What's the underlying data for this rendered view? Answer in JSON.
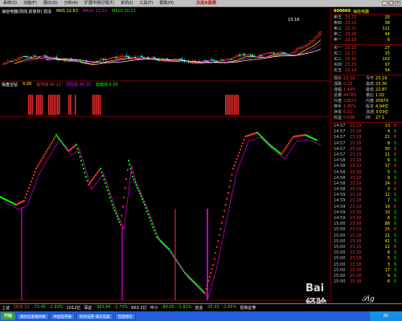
{
  "menubar": {
    "items": [
      "系统(S)",
      "功能(F)",
      "报价(Q)",
      "分析(A)",
      "扩展市场行情(T)",
      "资讯(I)",
      "工具(T)",
      "帮助(H)"
    ],
    "alert": "沉淀水股票"
  },
  "chart_header": {
    "stock": "海信电器(周线,前复权) 隐没",
    "ma5": "MA5 22.83",
    "ma10": "MA10 21.33",
    "ma20": "MA20 20.11"
  },
  "price_label": "23.18",
  "sub_header": {
    "name": "操盘宝钻",
    "v1": "0.00",
    "v2": "操作线 45.12",
    "v3": "风险线 60.15",
    "v4": "稳健线 0.00"
  },
  "quote": {
    "code": "600060",
    "name": "海信电器",
    "asks": [
      {
        "label": "卖五",
        "price": "23.23",
        "vol": "20"
      },
      {
        "label": "卖四",
        "price": "23.22",
        "vol": "38"
      },
      {
        "label": "卖三",
        "price": "23.21",
        "vol": "111"
      },
      {
        "label": "卖二",
        "price": "23.20",
        "vol": "44"
      },
      {
        "label": "卖一",
        "price": "23.19",
        "vol": "6"
      }
    ],
    "bids": [
      {
        "label": "买一",
        "price": "23.18",
        "vol": "27"
      },
      {
        "label": "买二",
        "price": "23.17",
        "vol": "15"
      },
      {
        "label": "买三",
        "price": "23.16",
        "vol": "102"
      },
      {
        "label": "买四",
        "price": "23.15",
        "vol": "97"
      },
      {
        "label": "买五",
        "price": "23.14",
        "vol": "54"
      }
    ],
    "stats": [
      {
        "l1": "现价",
        "v1": "23.18",
        "l2": "今开",
        "v2": "23.19"
      },
      {
        "l1": "涨跌",
        "v1": "0.33",
        "l2": "最高",
        "v2": "23.30"
      },
      {
        "l1": "涨幅",
        "v1": "1.44%",
        "l2": "最低",
        "v2": "22.87"
      },
      {
        "l1": "总量",
        "v1": "44783",
        "l2": "量比",
        "v2": "1.02"
      },
      {
        "l1": "外盘",
        "v1": "23813",
        "l2": "内盘",
        "v2": "20970"
      },
      {
        "l1": "换手",
        "v1": "1.45%",
        "l2": "股本",
        "v2": "4.94亿"
      },
      {
        "l1": "净资",
        "v1": "6.51",
        "l2": "流通",
        "v2": "3.03亿"
      },
      {
        "l1": "收益",
        "v1": "0.638",
        "l2": "PE",
        "v2": "27.1"
      }
    ],
    "ticks": [
      {
        "t": "14:57",
        "p": "23.19",
        "v": "13",
        "bs": "B"
      },
      {
        "t": "14:57",
        "p": "23.18",
        "v": "4",
        "bs": "S"
      },
      {
        "t": "14:57",
        "p": "23.19",
        "v": "21",
        "bs": "B"
      },
      {
        "t": "14:57",
        "p": "23.18",
        "v": "8",
        "bs": "S"
      },
      {
        "t": "14:57",
        "p": "23.18",
        "v": "30",
        "bs": "S"
      },
      {
        "t": "14:57",
        "p": "23.19",
        "v": "11",
        "bs": "B"
      },
      {
        "t": "14:58",
        "p": "23.18",
        "v": "6",
        "bs": "S"
      },
      {
        "t": "14:58",
        "p": "23.19",
        "v": "17",
        "bs": "B"
      },
      {
        "t": "14:58",
        "p": "23.18",
        "v": "5",
        "bs": "S"
      },
      {
        "t": "14:58",
        "p": "23.18",
        "v": "9",
        "bs": "S"
      },
      {
        "t": "14:58",
        "p": "23.19",
        "v": "24",
        "bs": "B"
      },
      {
        "t": "14:58",
        "p": "23.19",
        "v": "3",
        "bs": "B"
      },
      {
        "t": "14:59",
        "p": "23.18",
        "v": "12",
        "bs": "S"
      },
      {
        "t": "14:59",
        "p": "23.18",
        "v": "7",
        "bs": "S"
      },
      {
        "t": "14:59",
        "p": "23.19",
        "v": "19",
        "bs": "B"
      },
      {
        "t": "14:59",
        "p": "23.18",
        "v": "10",
        "bs": "S"
      },
      {
        "t": "14:59",
        "p": "23.18",
        "v": "6",
        "bs": "S"
      },
      {
        "t": "15:00",
        "p": "23.18",
        "v": "88",
        "bs": "S"
      },
      {
        "t": "15:00",
        "p": "23.19",
        "v": "15",
        "bs": "B"
      },
      {
        "t": "15:00",
        "p": "23.18",
        "v": "22",
        "bs": "S"
      },
      {
        "t": "15:00",
        "p": "23.18",
        "v": "41",
        "bs": "S"
      },
      {
        "t": "15:00",
        "p": "23.19",
        "v": "12",
        "bs": "B"
      },
      {
        "t": "15:00",
        "p": "23.18",
        "v": "8",
        "bs": "S"
      },
      {
        "t": "15:00",
        "p": "23.18",
        "v": "5",
        "bs": "S"
      },
      {
        "t": "15:00",
        "p": "23.18",
        "v": "3",
        "bs": "S"
      },
      {
        "t": "15:00",
        "p": "23.18",
        "v": "17",
        "bs": "S"
      },
      {
        "t": "15:00",
        "p": "23.18",
        "v": "9",
        "bs": "S"
      },
      {
        "t": "15:00",
        "p": "23.18",
        "v": "6",
        "bs": "S"
      }
    ]
  },
  "statusbar": {
    "items": [
      {
        "text": "上证",
        "cls": "idx"
      },
      {
        "text": "3808.52",
        "cls": "up"
      },
      {
        "text": "-73.45",
        "cls": "dn"
      },
      {
        "text": "-1.93%",
        "cls": "dn"
      },
      {
        "text": "1012亿",
        "cls": "idx"
      },
      {
        "text": "深证",
        "cls": "idx"
      },
      {
        "text": "-383.84",
        "cls": "dn"
      },
      {
        "text": "-2.73%",
        "cls": "dn"
      },
      {
        "text": "663.2亿",
        "cls": "idx"
      },
      {
        "text": "中小",
        "cls": "idx"
      },
      {
        "text": "-89.05",
        "cls": "dn"
      },
      {
        "text": "-1.82%",
        "cls": "dn"
      },
      {
        "text": "创业",
        "cls": "idx"
      },
      {
        "text": "-35.93",
        "cls": "dn"
      },
      {
        "text": "-2.85%",
        "cls": "dn"
      },
      {
        "text": "招商证券",
        "cls": "idx"
      }
    ]
  },
  "taskbar": {
    "start": "开始",
    "tasks": [
      "通达信金融终端",
      "中国证券报",
      "招商证券-海信电器",
      "百度经验"
    ],
    "tray": "80"
  },
  "watermark": "Bai 经验",
  "colors": {
    "up": "#ff3030",
    "down": "#00ff00",
    "ma5": "#ffff00",
    "ma10": "#ff00ff",
    "ma20": "#00ff00",
    "frame": "#800000"
  }
}
